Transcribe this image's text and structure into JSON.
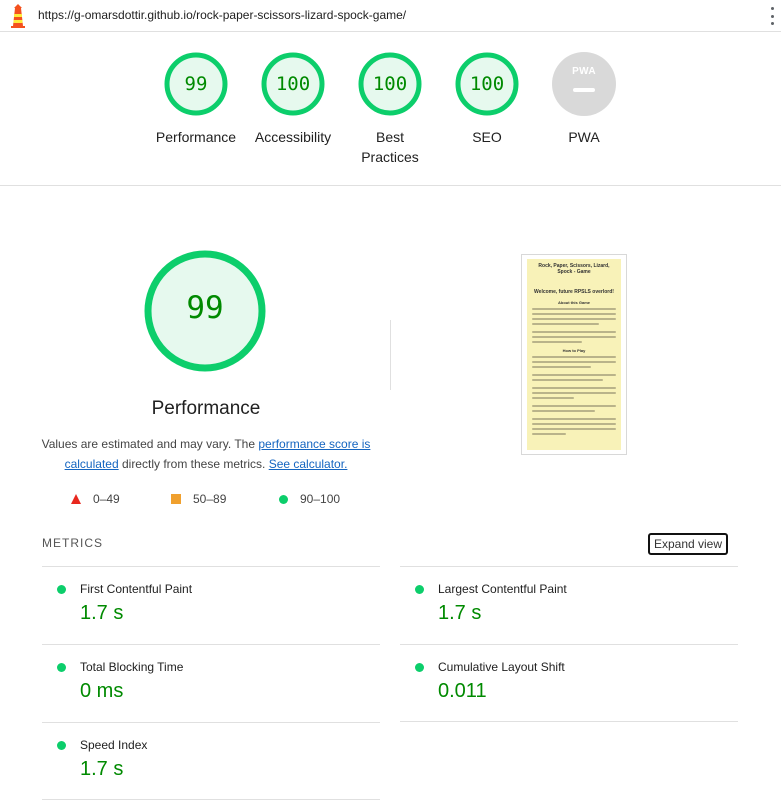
{
  "url": "https://g-omarsdottir.github.io/rock-paper-scissors-lizard-spock-game/",
  "gauges": [
    {
      "score": "99",
      "label": "Performance"
    },
    {
      "score": "100",
      "label": "Accessibility"
    },
    {
      "score": "100",
      "label": "Best Practices"
    },
    {
      "score": "100",
      "label": "SEO"
    },
    {
      "badge": "PWA",
      "label": "PWA"
    }
  ],
  "performance": {
    "score": "99",
    "score_fraction": 0.99,
    "title": "Performance",
    "desc_prefix": "Values are estimated and may vary. The ",
    "desc_link1": "performance score is calculated",
    "desc_middle": " directly from these metrics. ",
    "desc_link2": "See calculator."
  },
  "legend": {
    "fail": "0–49",
    "average": "50–89",
    "pass": "90–100"
  },
  "thumbnail": {
    "title": "Rock, Paper, Scissors, Lizard, Spock - Game",
    "heading": "Welcome, future RPSLS overlord!",
    "sub1": "About this Game",
    "sub2": "How to Play"
  },
  "metrics": {
    "header": "METRICS",
    "expand_label": "Expand view",
    "items": [
      {
        "name": "First Contentful Paint",
        "value": "1.7 s"
      },
      {
        "name": "Largest Contentful Paint",
        "value": "1.7 s"
      },
      {
        "name": "Total Blocking Time",
        "value": "0 ms"
      },
      {
        "name": "Cumulative Layout Shift",
        "value": "0.011"
      },
      {
        "name": "Speed Index",
        "value": "1.7 s"
      }
    ]
  },
  "colors": {
    "pass_green": "#0cce6b",
    "pass_text": "#008a00",
    "pass_bg": "#e6f9ee",
    "average_orange": "#f0a02e",
    "fail_red": "#e8271e",
    "na_grey": "#d9d9d9",
    "link_blue": "#1565c0"
  },
  "icons": {
    "logo": "lighthouse-icon",
    "menu": "kebab-menu-icon"
  }
}
